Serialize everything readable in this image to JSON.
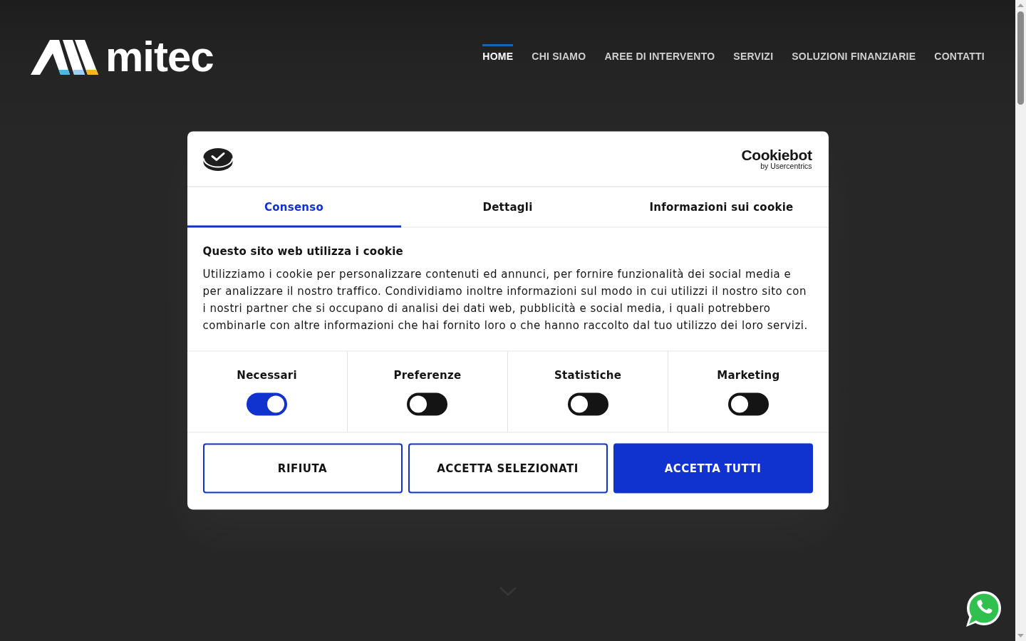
{
  "header": {
    "logo_text": "mitec",
    "nav": [
      {
        "label": "HOME",
        "selected": true
      },
      {
        "label": "CHI SIAMO",
        "selected": false
      },
      {
        "label": "AREE DI INTERVENTO",
        "selected": false
      },
      {
        "label": "SERVIZI",
        "selected": false
      },
      {
        "label": "SOLUZIONI FINANZIARIE",
        "selected": false
      },
      {
        "label": "CONTATTI",
        "selected": false
      }
    ]
  },
  "cookie_dialog": {
    "brand": {
      "name": "Cookiebot",
      "byline": "by Usercentrics"
    },
    "tabs": [
      {
        "label": "Consenso",
        "selected": true
      },
      {
        "label": "Dettagli",
        "selected": false
      },
      {
        "label": "Informazioni sui cookie",
        "selected": false
      }
    ],
    "title": "Questo sito web utilizza i cookie",
    "text": "Utilizziamo i cookie per personalizzare contenuti ed annunci, per fornire funzionalità dei social media e per analizzare il nostro traffico. Condividiamo inoltre informazioni sul modo in cui utilizzi il nostro sito con i nostri partner che si occupano di analisi dei dati web, pubblicità e social media, i quali potrebbero combinarle con altre informazioni che hai fornito loro o che hanno raccolto dal tuo utilizzo dei loro servizi.",
    "categories": [
      {
        "label": "Necessari",
        "on": true
      },
      {
        "label": "Preferenze",
        "on": false
      },
      {
        "label": "Statistiche",
        "on": false
      },
      {
        "label": "Marketing",
        "on": false
      }
    ],
    "buttons": [
      {
        "label": "RIFIUTA",
        "kind": "outline"
      },
      {
        "label": "ACCETTA SELEZIONATI",
        "kind": "outline"
      },
      {
        "label": "ACCETTA TUTTI",
        "kind": "primary"
      }
    ]
  }
}
